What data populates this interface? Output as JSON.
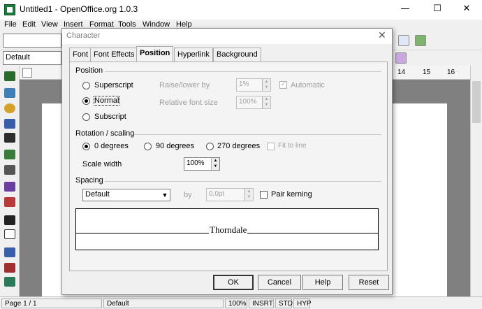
{
  "window": {
    "title": "Untitled1 - OpenOffice.org 1.0.3",
    "minimize": "—",
    "maximize": "☐",
    "close": "✕"
  },
  "menubar": [
    "File",
    "Edit",
    "View",
    "Insert",
    "Format",
    "Tools",
    "Window",
    "Help"
  ],
  "toolbar": {
    "style_combo": "Default"
  },
  "ruler": {
    "marks": [
      "14",
      "15",
      "16"
    ]
  },
  "statusbar": {
    "page": "Page 1 / 1",
    "style": "Default",
    "zoom": "100%",
    "insert": "INSRT",
    "select": "STD",
    "hyphen": "HYP"
  },
  "dialog": {
    "title": "Character",
    "tabs": [
      "Font",
      "Font Effects",
      "Position",
      "Hyperlink",
      "Background"
    ],
    "active_tab": "Position",
    "position": {
      "legend": "Position",
      "superscript": "Superscript",
      "normal": "Normal",
      "subscript": "Subscript",
      "selected": "Normal",
      "raise_lower_label": "Raise/lower by",
      "raise_lower_value": "1%",
      "automatic_label": "Automatic",
      "automatic_checked": true,
      "rel_font_size_label": "Relative font size",
      "rel_font_size_value": "100%"
    },
    "rotation": {
      "legend": "Rotation / scaling",
      "opt0": "0 degrees",
      "opt90": "90 degrees",
      "opt270": "270 degrees",
      "selected": "0 degrees",
      "fit_to_line": "Fit to line",
      "scale_width_label": "Scale width",
      "scale_width_value": "100%"
    },
    "spacing": {
      "legend": "Spacing",
      "mode": "Default",
      "by_label": "by",
      "by_value": "0,0pt",
      "pair_kerning": "Pair kerning",
      "pair_kerning_checked": false
    },
    "preview_text": "Thorndale",
    "buttons": {
      "ok": "OK",
      "cancel": "Cancel",
      "help": "Help",
      "reset": "Reset"
    },
    "close": "✕"
  }
}
